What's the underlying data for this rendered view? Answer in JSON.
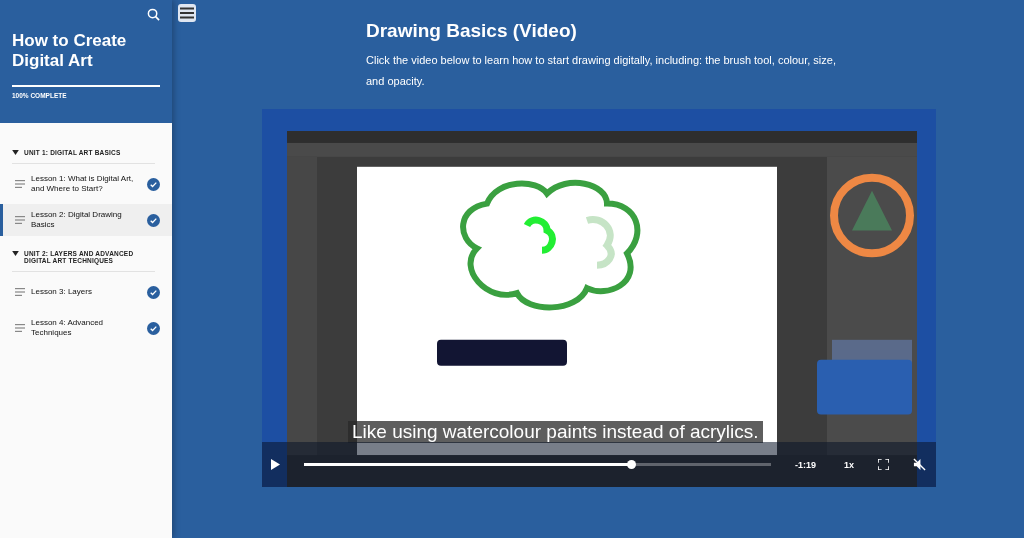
{
  "course": {
    "title": "How to Create Digital Art",
    "progress_label": "100% COMPLETE"
  },
  "units": [
    {
      "title": "UNIT 1: DIGITAL ART BASICS",
      "expanded": true,
      "lessons": [
        {
          "title": "Lesson 1: What is Digital Art, and Where to Start?",
          "selected": false,
          "completed": true
        },
        {
          "title": "Lesson 2: Digital Drawing Basics",
          "selected": true,
          "completed": true
        }
      ]
    },
    {
      "title": "UNIT 2: LAYERS AND ADVANCED DIGITAL ART TECHNIQUES",
      "expanded": true,
      "lessons": [
        {
          "title": "Lesson 3: Layers",
          "selected": false,
          "completed": true
        },
        {
          "title": "Lesson 4: Advanced Techniques",
          "selected": false,
          "completed": true
        }
      ]
    }
  ],
  "lesson": {
    "title": "Drawing Basics (Video)",
    "description": "Click the video below to learn how to start drawing digitally, including: the brush tool, colour, size, and opacity."
  },
  "video": {
    "kind": "picture",
    "caption": "Like using watercolour paints instead of acrylics.",
    "progress": {
      "level": 0.7
    },
    "time_remaining": "-1:19",
    "speed": "1x",
    "muted": true
  }
}
